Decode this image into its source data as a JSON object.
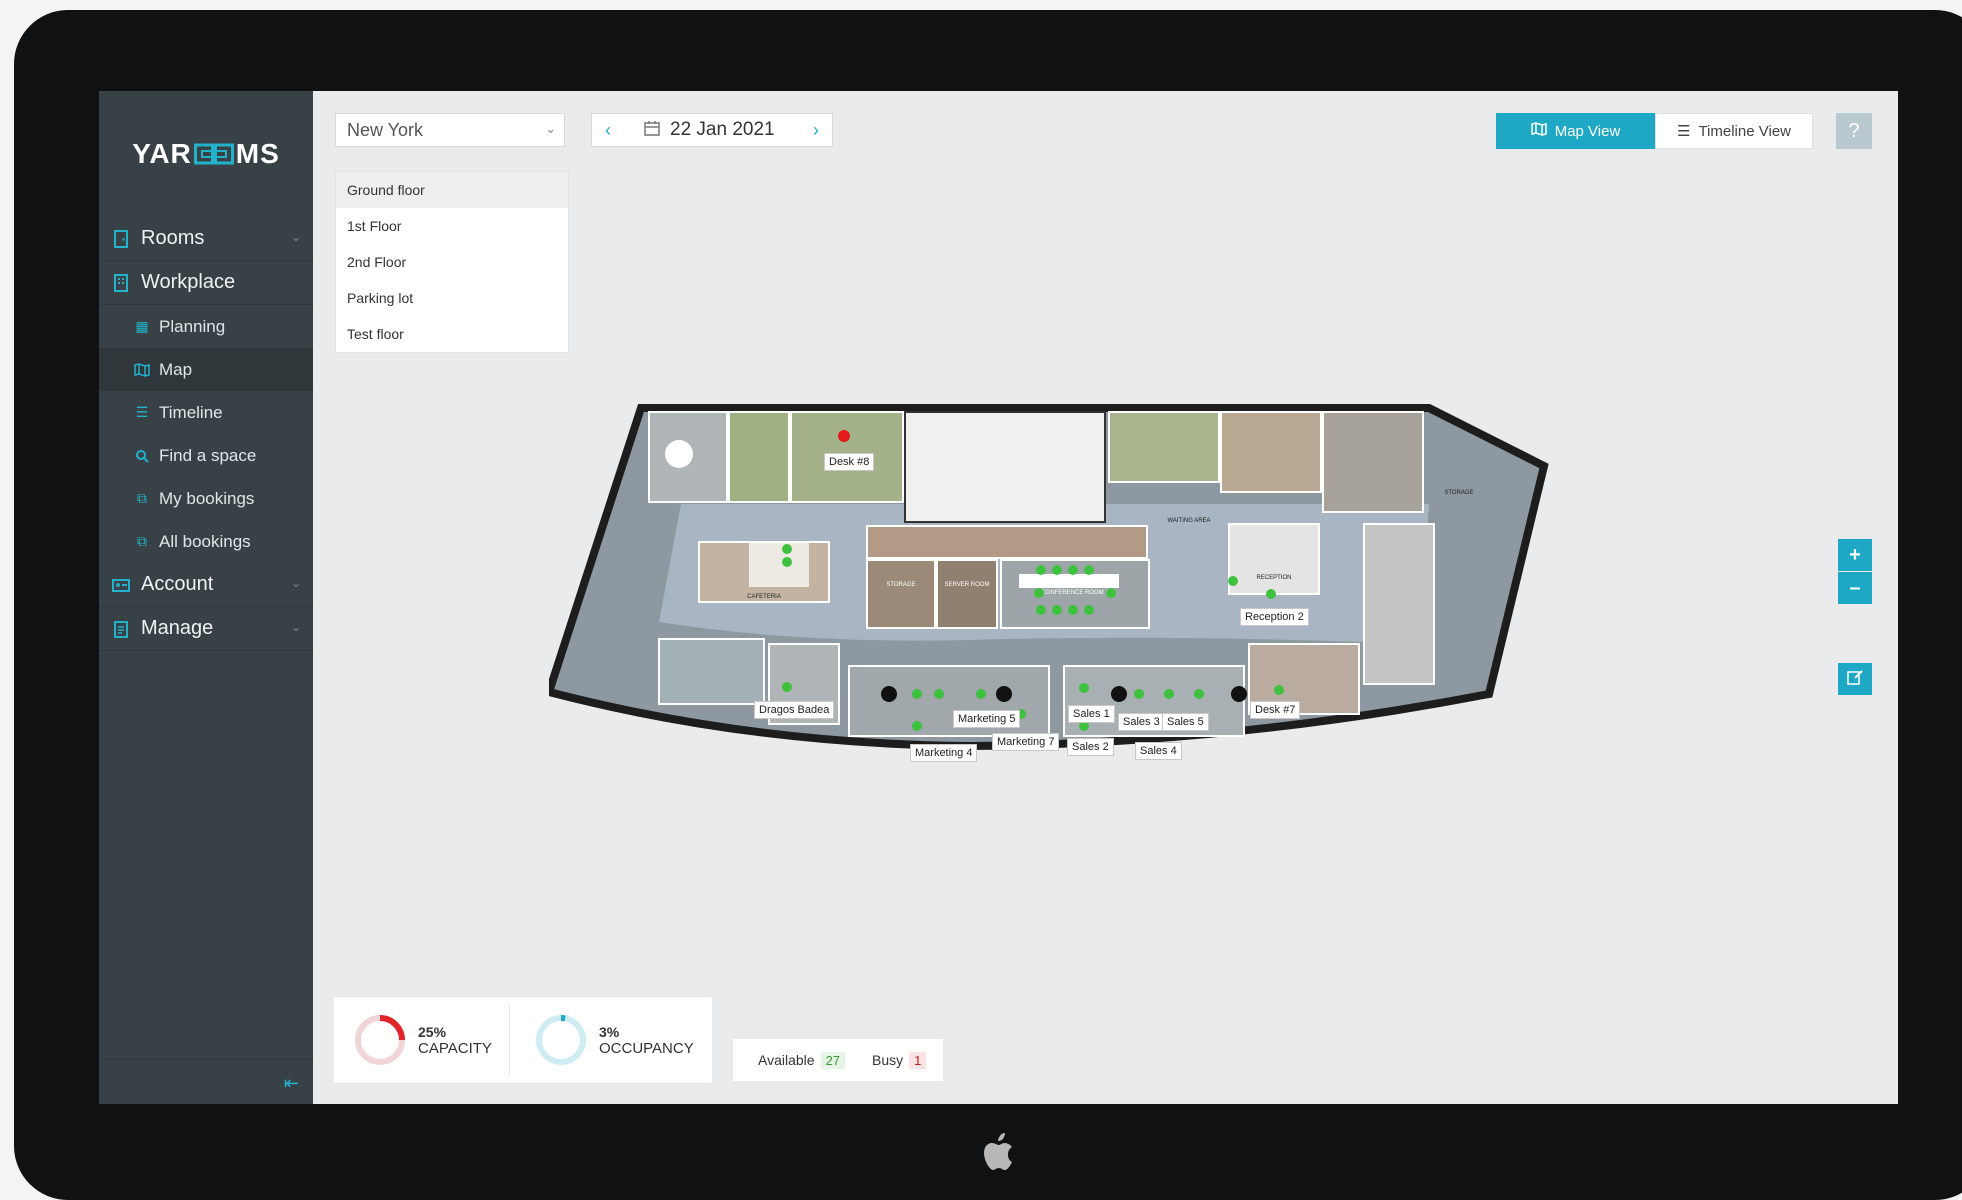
{
  "app": {
    "logo_left": "YAR",
    "logo_right": "MS"
  },
  "sidebar": {
    "items": [
      {
        "label": "Rooms",
        "icon": "door-icon",
        "has_chevron": true
      },
      {
        "label": "Workplace",
        "icon": "building-icon",
        "has_chevron": false
      },
      {
        "label": "Account",
        "icon": "id-card-icon",
        "has_chevron": true
      },
      {
        "label": "Manage",
        "icon": "clipboard-icon",
        "has_chevron": true
      }
    ],
    "workplace_sub": [
      {
        "label": "Planning",
        "icon": "grid-icon"
      },
      {
        "label": "Map",
        "icon": "map-icon",
        "active": true
      },
      {
        "label": "Timeline",
        "icon": "list-icon"
      },
      {
        "label": "Find a space",
        "icon": "search-icon"
      },
      {
        "label": "My bookings",
        "icon": "bookings-icon"
      },
      {
        "label": "All bookings",
        "icon": "bookings-icon"
      }
    ]
  },
  "toolbar": {
    "location": "New York",
    "date": "22 Jan 2021",
    "map_view_label": "Map View",
    "timeline_view_label": "Timeline View",
    "help_label": "?"
  },
  "floors": [
    "Ground floor",
    "1st Floor",
    "2nd Floor",
    "Parking lot",
    "Test floor"
  ],
  "selected_floor": "Ground floor",
  "map": {
    "zoom_in": "+",
    "zoom_out": "–",
    "desks": [
      {
        "label": "Desk #8",
        "status": "busy"
      },
      {
        "label": "Reception 2",
        "status": "available"
      },
      {
        "label": "Dragos Badea",
        "status": "available"
      },
      {
        "label": "Marketing 5",
        "status": "available"
      },
      {
        "label": "Marketing 7",
        "status": "available"
      },
      {
        "label": "Marketing 4",
        "status": "available"
      },
      {
        "label": "Sales 1",
        "status": "available"
      },
      {
        "label": "Sales 2",
        "status": "available"
      },
      {
        "label": "Sales 3",
        "status": "available"
      },
      {
        "label": "Sales 5",
        "status": "available"
      },
      {
        "label": "Sales 4",
        "status": "available"
      },
      {
        "label": "Desk #7",
        "status": "available"
      }
    ],
    "room_labels": [
      "CAFETERIA",
      "STORAGE",
      "SERVER ROOM",
      "CONFERENCE ROOM 1",
      "RECEPTION",
      "STORAGE",
      "WAITING AREA"
    ]
  },
  "stats": {
    "capacity_pct": "25%",
    "capacity_label": "CAPACITY",
    "capacity_value": 0.25,
    "occupancy_pct": "3%",
    "occupancy_label": "OCCUPANCY",
    "occupancy_value": 0.03
  },
  "legend": {
    "available_label": "Available",
    "available_count": "27",
    "busy_label": "Busy",
    "busy_count": "1"
  },
  "colors": {
    "accent": "#1fa8c6",
    "sidebar": "#384246",
    "available": "#3ec23e",
    "busy": "#e21b1b",
    "capacity_ring": "#e2242b",
    "occupancy_ring": "#1fa8c6"
  }
}
